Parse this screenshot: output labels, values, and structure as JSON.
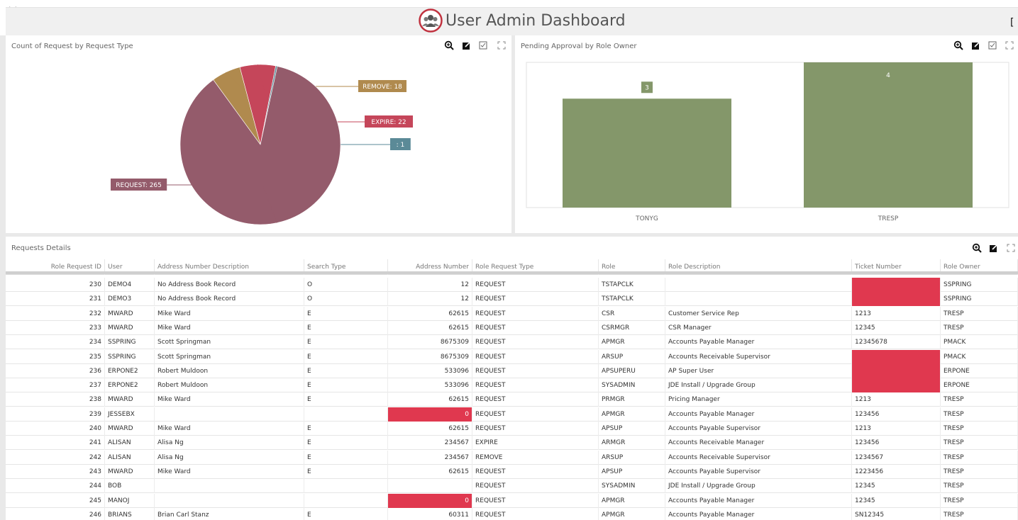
{
  "header": {
    "title": "User Admin Dashboard",
    "corner_glyph": "["
  },
  "pie_panel": {
    "title": "Count of Request by Request Type",
    "tools": [
      "zoom-icon",
      "export-icon",
      "multiselect-icon",
      "fullscreen-icon"
    ]
  },
  "bar_panel": {
    "title": "Pending Approval by Role Owner",
    "tools": [
      "zoom-icon",
      "export-icon",
      "multiselect-icon",
      "fullscreen-icon"
    ]
  },
  "chart_data": [
    {
      "type": "pie",
      "title": "Count of Request by Request Type",
      "slices": [
        {
          "label": "REQUEST",
          "value": 265,
          "color": "#945b6b",
          "label_text": "REQUEST: 265"
        },
        {
          "label": "REMOVE",
          "value": 18,
          "color": "#b08a4e",
          "label_text": "REMOVE: 18"
        },
        {
          "label": "EXPIRE",
          "value": 22,
          "color": "#c5465a",
          "label_text": "EXPIRE: 22"
        },
        {
          "label": "",
          "value": 1,
          "color": "#5b8a97",
          "label_text": ": 1"
        }
      ]
    },
    {
      "type": "bar",
      "title": "Pending Approval by Role Owner",
      "categories": [
        "TONYG",
        "TRESP"
      ],
      "values": [
        3,
        4
      ],
      "ylim": [
        0,
        4
      ],
      "color": "#84976a",
      "grid": false
    }
  ],
  "table": {
    "title": "Requests Details",
    "tools": [
      "zoom-icon",
      "export-icon",
      "fullscreen-icon"
    ],
    "highlight_color": "#e0384f",
    "columns": [
      "Role Request ID",
      "User",
      "Address Number Description",
      "Search Type",
      "Address Number",
      "Role Request Type",
      "Role",
      "Role Description",
      "Ticket Number",
      "Role Owner"
    ],
    "rows": [
      [
        "230",
        "DEMO4",
        "No Address Book Record",
        "O",
        "12",
        "REQUEST",
        "TSTAPCLK",
        "",
        "",
        "SSPRING"
      ],
      [
        "231",
        "DEMO3",
        "No Address Book Record",
        "O",
        "12",
        "REQUEST",
        "TSTAPCLK",
        "",
        "",
        "SSPRING"
      ],
      [
        "232",
        "MWARD",
        "Mike Ward",
        "E",
        "62615",
        "REQUEST",
        "CSR",
        "Customer Service Rep",
        "1213",
        "TRESP"
      ],
      [
        "233",
        "MWARD",
        "Mike Ward",
        "E",
        "62615",
        "REQUEST",
        "CSRMGR",
        "CSR Manager",
        "12345",
        "TRESP"
      ],
      [
        "234",
        "SSPRING",
        "Scott Springman",
        "E",
        "8675309",
        "REQUEST",
        "APMGR",
        "Accounts Payable Manager",
        "12345678",
        "PMACK"
      ],
      [
        "235",
        "SSPRING",
        "Scott Springman",
        "E",
        "8675309",
        "REQUEST",
        "ARSUP",
        "Accounts Receivable Supervisor",
        "",
        "PMACK"
      ],
      [
        "236",
        "ERPONE2",
        "Robert Muldoon",
        "E",
        "533096",
        "REQUEST",
        "APSUPERU",
        "AP Super User",
        "",
        "ERPONE"
      ],
      [
        "237",
        "ERPONE2",
        "Robert Muldoon",
        "E",
        "533096",
        "REQUEST",
        "SYSADMIN",
        "JDE Install / Upgrade Group",
        "",
        "ERPONE"
      ],
      [
        "238",
        "MWARD",
        "Mike Ward",
        "E",
        "62615",
        "REQUEST",
        "PRMGR",
        "Pricing Manager",
        "1213",
        "TRESP"
      ],
      [
        "239",
        "JESSEBX",
        "",
        "",
        "0",
        "REQUEST",
        "APMGR",
        "Accounts Payable Manager",
        "123456",
        "TRESP"
      ],
      [
        "240",
        "MWARD",
        "Mike Ward",
        "E",
        "62615",
        "REQUEST",
        "APSUP",
        "Accounts Payable Supervisor",
        "1213",
        "TRESP"
      ],
      [
        "241",
        "ALISAN",
        "Alisa Ng",
        "E",
        "234567",
        "EXPIRE",
        "ARMGR",
        "Accounts Receivable Manager",
        "123456",
        "TRESP"
      ],
      [
        "242",
        "ALISAN",
        "Alisa Ng",
        "E",
        "234567",
        "REMOVE",
        "ARSUP",
        "Accounts Receivable Supervisor",
        "1234567",
        "TRESP"
      ],
      [
        "243",
        "MWARD",
        "Mike Ward",
        "E",
        "62615",
        "REQUEST",
        "APSUP",
        "Accounts Payable Supervisor",
        "1223456",
        "TRESP"
      ],
      [
        "244",
        "BOB",
        "",
        "",
        "",
        "REQUEST",
        "SYSADMIN",
        "JDE Install / Upgrade Group",
        "12345",
        "TRESP"
      ],
      [
        "245",
        "MANOJ",
        "",
        "",
        "0",
        "REQUEST",
        "APMGR",
        "Accounts Payable Manager",
        "12345",
        "TRESP"
      ],
      [
        "246",
        "BRIANS",
        "Brian Carl Stanz",
        "E",
        "60311",
        "REQUEST",
        "APMGR",
        "Accounts Payable Manager",
        "SN12345",
        "TRESP"
      ]
    ]
  }
}
